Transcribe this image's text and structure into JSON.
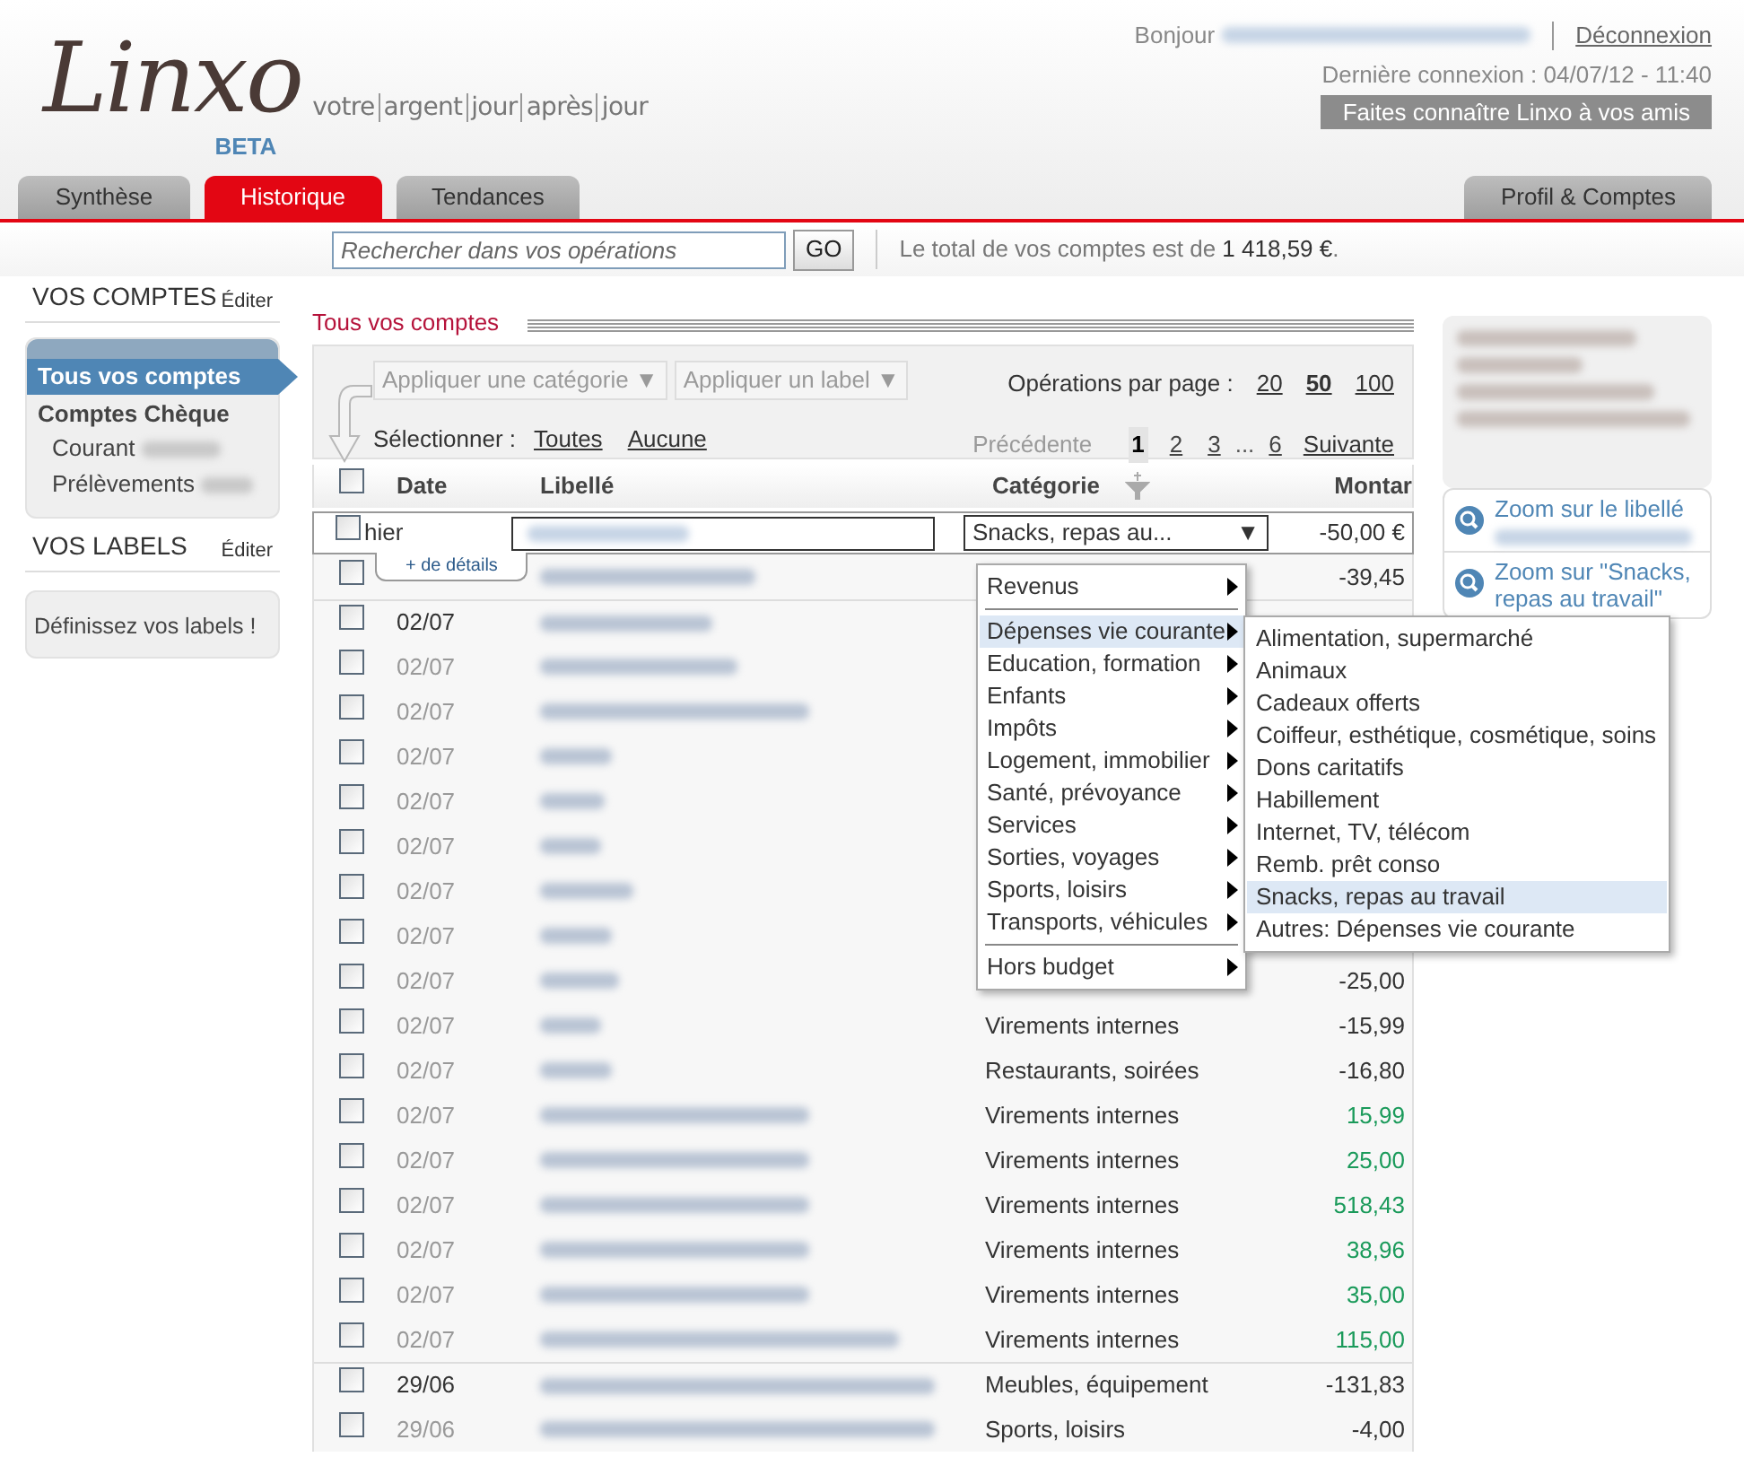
{
  "header": {
    "logo": "Linxo",
    "badge": "BETA",
    "tagline": [
      "votre",
      "argent",
      "jour",
      "après",
      "jour"
    ],
    "greeting": "Bonjour",
    "logout": "Déconnexion",
    "last_login": "Dernière connexion : 04/07/12 - 11:40",
    "invite_button": "Faites connaître Linxo à vos amis"
  },
  "tabs": [
    {
      "label": "Synthèse",
      "selected": false
    },
    {
      "label": "Historique",
      "selected": true
    },
    {
      "label": "Tendances",
      "selected": false
    },
    {
      "label": "Profil & Comptes",
      "selected": false
    }
  ],
  "search": {
    "placeholder": "Rechercher dans vos opérations",
    "button": "GO",
    "total_text": "Le total de vos comptes est de",
    "total_value": "1 418,59 €",
    "total_end": "."
  },
  "sidebar": {
    "accounts_title": "VOS COMPTES",
    "accounts_edit": "Éditer",
    "items": [
      {
        "label": "Tous vos comptes",
        "kind": "all",
        "selected": true
      },
      {
        "label": "Comptes Chèque",
        "kind": "group",
        "selected": false
      },
      {
        "label": "Courant",
        "kind": "account",
        "selected": false
      },
      {
        "label": "Prélèvements",
        "kind": "account",
        "selected": false
      }
    ],
    "labels_title": "VOS LABELS",
    "labels_edit": "Éditer",
    "labels_prompt": "Définissez vos labels !"
  },
  "main": {
    "title": "Tous vos comptes",
    "apply_category": "Appliquer une catégorie ▼",
    "apply_label": "Appliquer un label ▼",
    "select_label": "Sélectionner :",
    "select_all": "Toutes",
    "select_none": "Aucune",
    "per_page_label": "Opérations par page :",
    "per_page": [
      {
        "label": "20",
        "selected": false
      },
      {
        "label": "50",
        "selected": true
      },
      {
        "label": "100",
        "selected": false
      }
    ],
    "previous": "Précédente",
    "next": "Suivante",
    "pages": [
      {
        "label": "1",
        "kind": "page",
        "selected": true
      },
      {
        "label": "2",
        "kind": "page",
        "selected": false
      },
      {
        "label": "3",
        "kind": "page",
        "selected": false
      },
      {
        "label": "...",
        "kind": "gap"
      },
      {
        "label": "6",
        "kind": "page",
        "selected": false
      }
    ]
  },
  "table": {
    "columns": [
      "Date",
      "Libellé",
      "Catégorie",
      "Montar"
    ],
    "header_checked": false,
    "editing_row": {
      "checked": false,
      "date": "hier",
      "category": "Snacks, repas au...",
      "arrow": "▼",
      "amount": "-50,00 €",
      "details": "+ de détails"
    },
    "rows": [
      {
        "checked": false,
        "first_of_day": false,
        "amount": "-39,45",
        "credit": false
      },
      {
        "checked": false,
        "first_of_day": true,
        "date": "02/07"
      },
      {
        "checked": false,
        "first_of_day": false,
        "date": "02/07"
      },
      {
        "checked": false,
        "first_of_day": false,
        "date": "02/07"
      },
      {
        "checked": false,
        "first_of_day": false,
        "date": "02/07"
      },
      {
        "checked": false,
        "first_of_day": false,
        "date": "02/07"
      },
      {
        "checked": false,
        "first_of_day": false,
        "date": "02/07"
      },
      {
        "checked": false,
        "first_of_day": false,
        "date": "02/07"
      },
      {
        "checked": false,
        "first_of_day": false,
        "date": "02/07"
      },
      {
        "checked": false,
        "first_of_day": false,
        "date": "02/07",
        "amount": "-25,00",
        "credit": false
      },
      {
        "checked": false,
        "first_of_day": false,
        "date": "02/07",
        "category": "Virements internes",
        "amount": "-15,99",
        "credit": false
      },
      {
        "checked": false,
        "first_of_day": false,
        "date": "02/07",
        "category": "Restaurants, soirées",
        "amount": "-16,80",
        "credit": false
      },
      {
        "checked": false,
        "first_of_day": false,
        "date": "02/07",
        "category": "Virements internes",
        "amount": "15,99",
        "credit": true
      },
      {
        "checked": false,
        "first_of_day": false,
        "date": "02/07",
        "category": "Virements internes",
        "amount": "25,00",
        "credit": true
      },
      {
        "checked": false,
        "first_of_day": false,
        "date": "02/07",
        "category": "Virements internes",
        "amount": "518,43",
        "credit": true
      },
      {
        "checked": false,
        "first_of_day": false,
        "date": "02/07",
        "category": "Virements internes",
        "amount": "38,96",
        "credit": true
      },
      {
        "checked": false,
        "first_of_day": false,
        "date": "02/07",
        "category": "Virements internes",
        "amount": "35,00",
        "credit": true
      },
      {
        "checked": false,
        "first_of_day": false,
        "date": "02/07",
        "category": "Virements internes",
        "amount": "115,00",
        "credit": true
      },
      {
        "checked": false,
        "first_of_day": true,
        "date": "29/06",
        "category": "Meubles, équipement",
        "amount": "-131,83",
        "credit": false
      },
      {
        "checked": false,
        "first_of_day": false,
        "date": "29/06",
        "category": "Sports, loisirs",
        "amount": "-4,00",
        "credit": false
      }
    ]
  },
  "category_menu": {
    "items": [
      {
        "label": "Revenus",
        "expanded": false,
        "divider_before": false
      },
      {
        "label": "Dépenses vie courante",
        "expanded": true,
        "divider_before": true
      },
      {
        "label": "Education, formation",
        "expanded": false,
        "divider_before": false
      },
      {
        "label": "Enfants",
        "expanded": false,
        "divider_before": false
      },
      {
        "label": "Impôts",
        "expanded": false,
        "divider_before": false
      },
      {
        "label": "Logement, immobilier",
        "expanded": false,
        "divider_before": false
      },
      {
        "label": "Santé, prévoyance",
        "expanded": false,
        "divider_before": false
      },
      {
        "label": "Services",
        "expanded": false,
        "divider_before": false
      },
      {
        "label": "Sorties, voyages",
        "expanded": false,
        "divider_before": false
      },
      {
        "label": "Sports, loisirs",
        "expanded": false,
        "divider_before": false
      },
      {
        "label": "Transports, véhicules",
        "expanded": false,
        "divider_before": false
      },
      {
        "label": "Hors budget",
        "expanded": false,
        "divider_before": true
      }
    ],
    "submenu": [
      {
        "label": "Alimentation, supermarché",
        "selected": false
      },
      {
        "label": "Animaux",
        "selected": false
      },
      {
        "label": "Cadeaux offerts",
        "selected": false
      },
      {
        "label": "Coiffeur, esthétique, cosmétique, soins",
        "selected": false
      },
      {
        "label": "Dons caritatifs",
        "selected": false
      },
      {
        "label": "Habillement",
        "selected": false
      },
      {
        "label": "Internet, TV, télécom",
        "selected": false
      },
      {
        "label": "Remb. prêt conso",
        "selected": false
      },
      {
        "label": "Snacks, repas au travail",
        "selected": true
      },
      {
        "label": "Autres: Dépenses vie courante",
        "selected": false
      }
    ]
  },
  "right_panel": {
    "zoom_links": [
      {
        "label": "Zoom sur le libellé",
        "kind": "label"
      },
      {
        "label": "Zoom sur \"Snacks, repas au travail\"",
        "kind": "category"
      }
    ]
  }
}
